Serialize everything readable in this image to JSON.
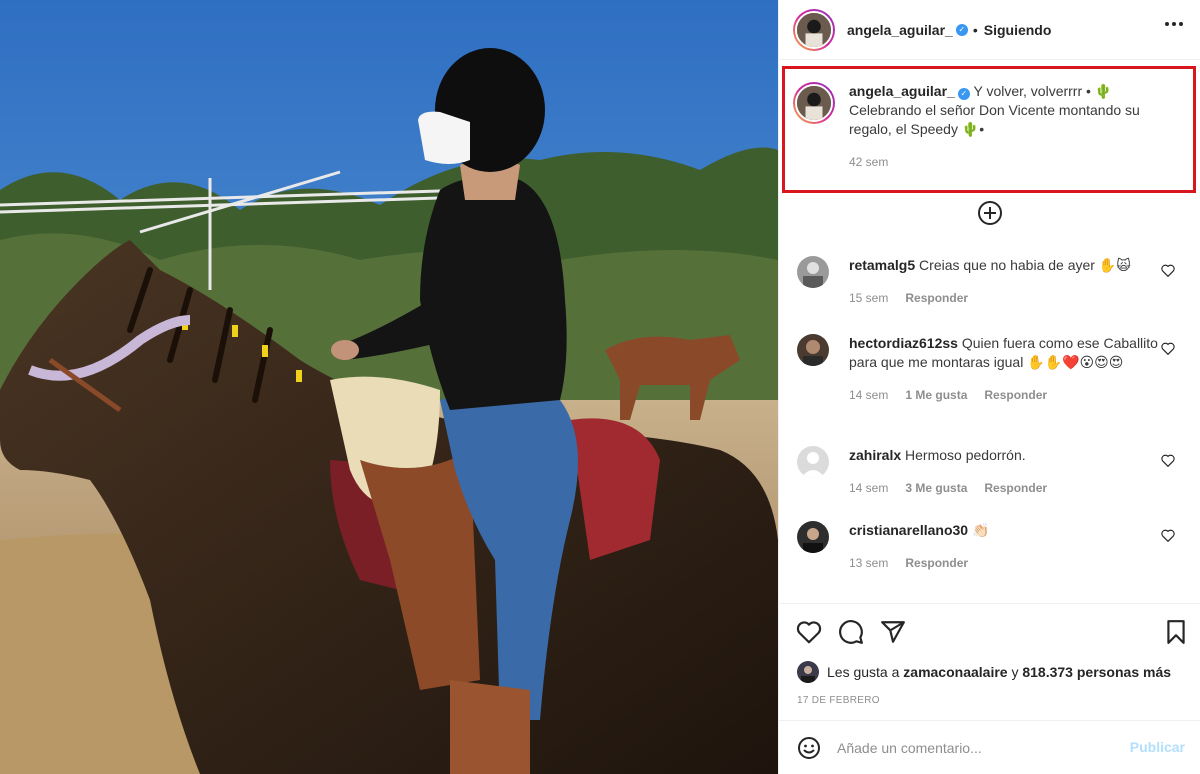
{
  "post": {
    "author": "angela_aguilar_",
    "follow_status": "Siguiendo",
    "separator": "•",
    "photo_alt": "",
    "caption": {
      "text": "Y volver, volverrrr • 🌵Celebrando el señor Don Vicente montando su regalo, el Speedy 🌵•",
      "time": "42 sem"
    }
  },
  "comments": [
    {
      "username": "retamalg5",
      "text": "Creias que no habia de ayer ✋🙀",
      "time": "15 sem",
      "likes": "",
      "reply": "Responder"
    },
    {
      "username": "hectordiaz612ss",
      "text": "Quien fuera como ese Caballito para que me montaras igual ✋✋❤️😮😍😍",
      "time": "14 sem",
      "likes": "1 Me gusta",
      "reply": "Responder"
    },
    {
      "username": "zahiralx",
      "text": "Hermoso pedorrón.",
      "time": "14 sem",
      "likes": "3 Me gusta",
      "reply": "Responder"
    },
    {
      "username": "cristianarellano30",
      "text": "👏🏻",
      "time": "13 sem",
      "likes": "",
      "reply": "Responder"
    }
  ],
  "likes": {
    "prefix": "Les gusta a",
    "user": "zamaconaalaire",
    "connector": "y",
    "count": "818.373 personas más"
  },
  "date": "17 DE FEBRERO",
  "comment_bar": {
    "placeholder": "Añade un comentario...",
    "publish": "Publicar"
  },
  "colors": {
    "highlight_box": "#d7161d",
    "verified": "#3897f0",
    "publish_disabled": "#b2dffc"
  },
  "icons": [
    "verified-badge-icon",
    "more-options-icon",
    "load-more-comments-icon",
    "heart-icon",
    "comment-icon",
    "share-icon",
    "bookmark-icon",
    "emoji-icon"
  ]
}
